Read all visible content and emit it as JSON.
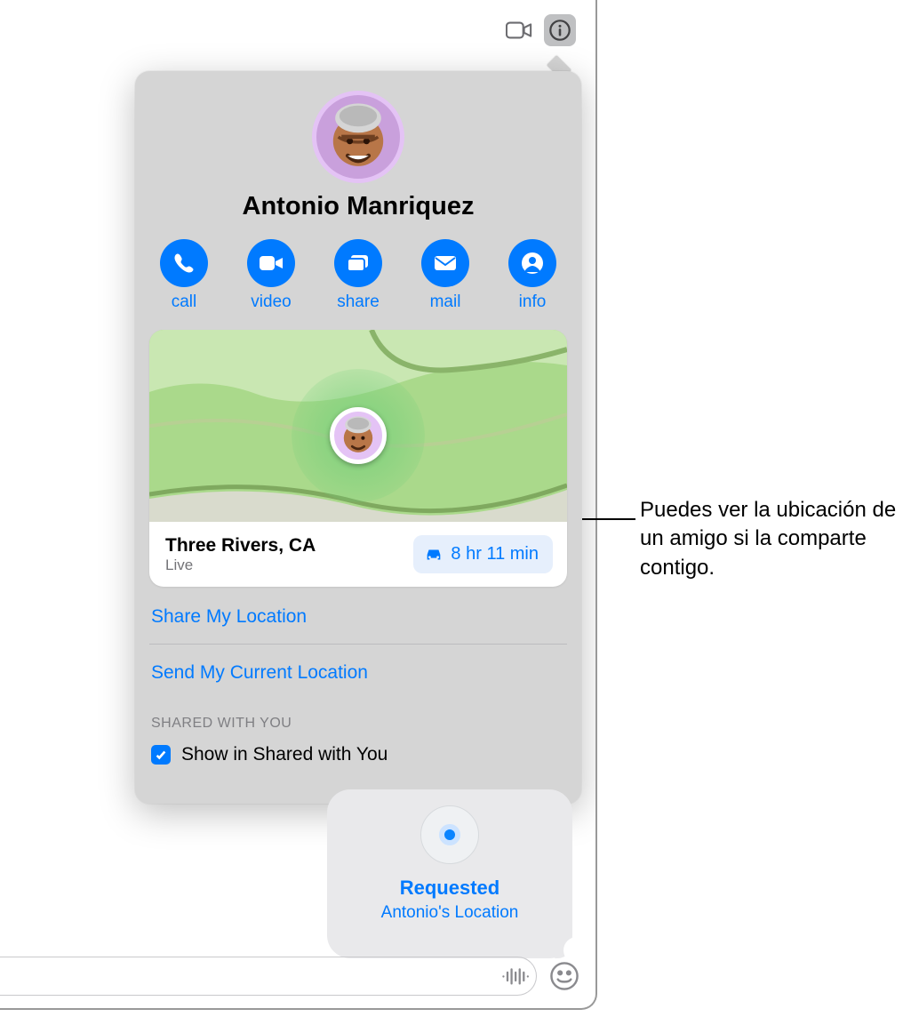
{
  "toolbar": {
    "video_icon": "camera-icon",
    "info_icon": "info-icon"
  },
  "popover": {
    "contact_name": "Antonio Manriquez",
    "avatar_icon": "memoji-avatar",
    "actions": [
      {
        "id": "call",
        "label": "call",
        "icon": "phone-icon"
      },
      {
        "id": "video",
        "label": "video",
        "icon": "video-icon"
      },
      {
        "id": "share",
        "label": "share",
        "icon": "screen-share-icon"
      },
      {
        "id": "mail",
        "label": "mail",
        "icon": "envelope-icon"
      },
      {
        "id": "info",
        "label": "info",
        "icon": "person-circle-icon"
      }
    ],
    "map": {
      "place": "Three Rivers, CA",
      "status": "Live",
      "eta": "8 hr 11 min",
      "eta_mode_icon": "car-icon"
    },
    "links": {
      "share_my_location": "Share My Location",
      "send_current_location": "Send My Current Location"
    },
    "section_header": "SHARED WITH YOU",
    "shared_with_you_checkbox": {
      "checked": true,
      "label": "Show in Shared with You"
    }
  },
  "message_bubble": {
    "icon": "location-dot-icon",
    "title": "Requested",
    "subtitle": "Antonio's Location"
  },
  "compose": {
    "mic_icon": "waveform-icon",
    "emoji_icon": "smile-icon"
  },
  "callout": {
    "text": "Puedes ver la ubicación de un amigo si la comparte contigo."
  }
}
